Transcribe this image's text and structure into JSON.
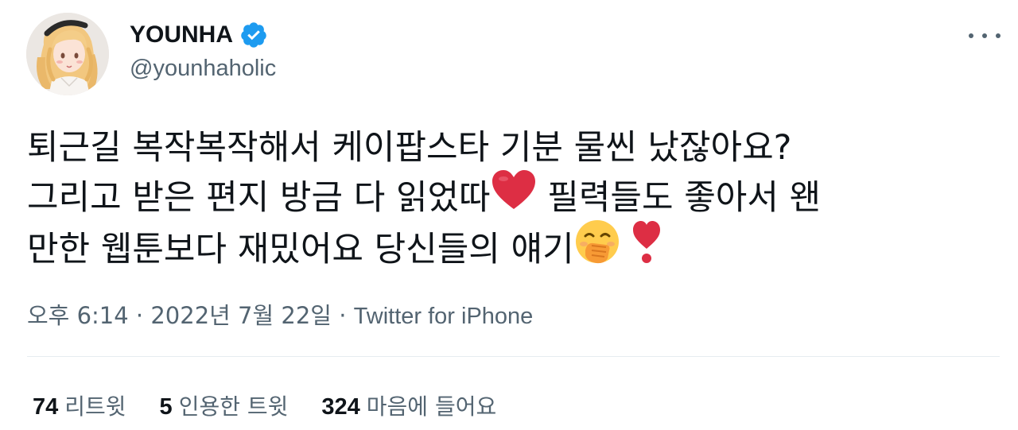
{
  "author": {
    "display_name": "YOUNHA",
    "handle": "@younhaholic",
    "verified": true,
    "accent_color": "#1d9bf0"
  },
  "menu": {
    "icon": "more-horizontal-icon"
  },
  "tweet": {
    "lines": [
      {
        "text": "퇴근길 복작복작해서 케이팝스타 기분 물씬 났잖아요?"
      },
      {
        "text": "그리고 받은 편지 방금 다 읽었따",
        "emoji": "red-heart-icon",
        "after": " 필력들도 좋아서 왠"
      },
      {
        "text": "만한 웹툰보다 재밌어요 당신들의 얘기",
        "emoji": "hand-over-mouth-face-icon",
        "emoji2": "heavy-exclamation-heart-icon"
      }
    ]
  },
  "meta": {
    "time": "오후 6:14",
    "separator": "·",
    "date": "2022년 7월 22일",
    "source": "Twitter for iPhone"
  },
  "stats": [
    {
      "count": "74",
      "label": "리트윗"
    },
    {
      "count": "5",
      "label": "인용한 트윗"
    },
    {
      "count": "324",
      "label": "마음에 들어요"
    }
  ]
}
